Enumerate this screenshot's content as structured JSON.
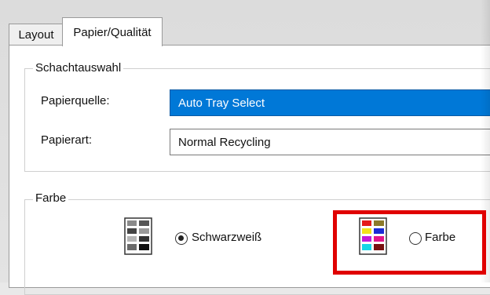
{
  "tabs": [
    {
      "label": "Layout"
    },
    {
      "label": "Papier/Qualität"
    }
  ],
  "tray_group": {
    "legend": "Schachtauswahl",
    "paper_source_label": "Papierquelle:",
    "paper_source_value": "Auto Tray Select",
    "paper_type_label": "Papierart:",
    "paper_type_value": "Normal  Recycling"
  },
  "color_group": {
    "legend": "Farbe",
    "option_bw_label": "Schwarzweiß",
    "option_color_label": "Farbe",
    "selected": "Schwarzweiß"
  },
  "colors": {
    "selection_blue": "#0078d7",
    "highlight_red": "#e00000"
  }
}
